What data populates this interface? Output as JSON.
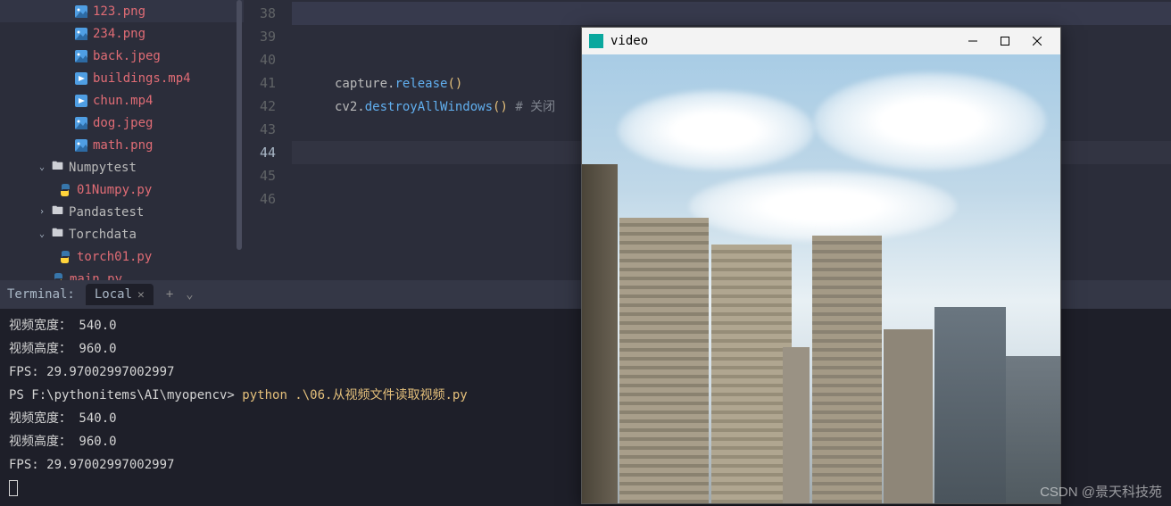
{
  "sidebar": {
    "items": [
      {
        "depth": "2",
        "icon": "img",
        "name": "123.png"
      },
      {
        "depth": "2",
        "icon": "img",
        "name": "234.png"
      },
      {
        "depth": "2",
        "icon": "img",
        "name": "back.jpeg"
      },
      {
        "depth": "2",
        "icon": "vid",
        "name": "buildings.mp4"
      },
      {
        "depth": "2",
        "icon": "vid",
        "name": "chun.mp4"
      },
      {
        "depth": "2",
        "icon": "img",
        "name": "dog.jpeg"
      },
      {
        "depth": "2",
        "icon": "img",
        "name": "math.png"
      },
      {
        "depth": "1",
        "chevron": "down",
        "icon": "folder",
        "name": "Numpytest",
        "plain": true
      },
      {
        "depth": "1b",
        "icon": "py",
        "name": "01Numpy.py"
      },
      {
        "depth": "1",
        "chevron": "right",
        "icon": "folder",
        "name": "Pandastest",
        "plain": true
      },
      {
        "depth": "1",
        "chevron": "down",
        "icon": "folder",
        "name": "Torchdata",
        "plain": true
      },
      {
        "depth": "1b",
        "icon": "py",
        "name": "torch01.py"
      },
      {
        "depth": "1",
        "chevron": "",
        "icon": "py",
        "name": "main.py",
        "pad": true
      }
    ]
  },
  "editor": {
    "lines": [
      "38",
      "39",
      "40",
      "41",
      "42",
      "43",
      "44",
      "45",
      "46"
    ],
    "current": "44",
    "code": {
      "l41_a": "capture",
      "l41_b": ".",
      "l41_c": "release",
      "l41_d": "()",
      "l42_a": "cv2",
      "l42_b": ".",
      "l42_c": "destroyAllWindows",
      "l42_d": "()",
      "l42_e": " # 关闭"
    }
  },
  "terminal": {
    "label": "Terminal:",
    "tab": "Local",
    "out": {
      "w": "视频宽度： 540.0",
      "h": "视频高度： 960.0",
      "fps": "FPS:  29.97002997002997",
      "ps": "PS F:\\pythonitems\\AI\\myopencv> ",
      "cmd": "python .\\06.从视频文件读取视频.py"
    }
  },
  "video_window": {
    "title": "video"
  },
  "watermark": "CSDN @景天科技苑"
}
